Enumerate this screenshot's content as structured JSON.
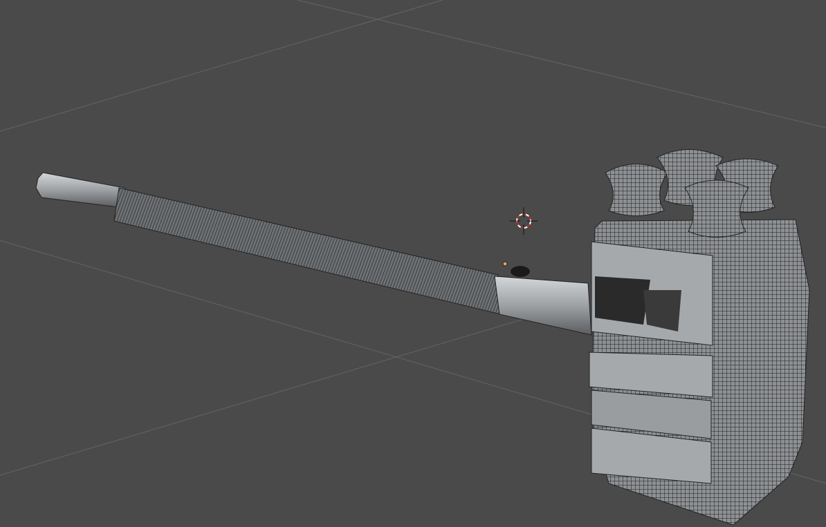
{
  "viewport": {
    "background_color": "#4a4a4a",
    "grid_color": "#5e5e5e",
    "mesh_fill": "#a9acae",
    "mesh_wire": "#1a1a1a",
    "cursor_color": "#c8281e",
    "origin_color": "#e8a060"
  },
  "icons": {
    "cursor": "3d-cursor-icon",
    "origin": "object-origin-icon"
  }
}
